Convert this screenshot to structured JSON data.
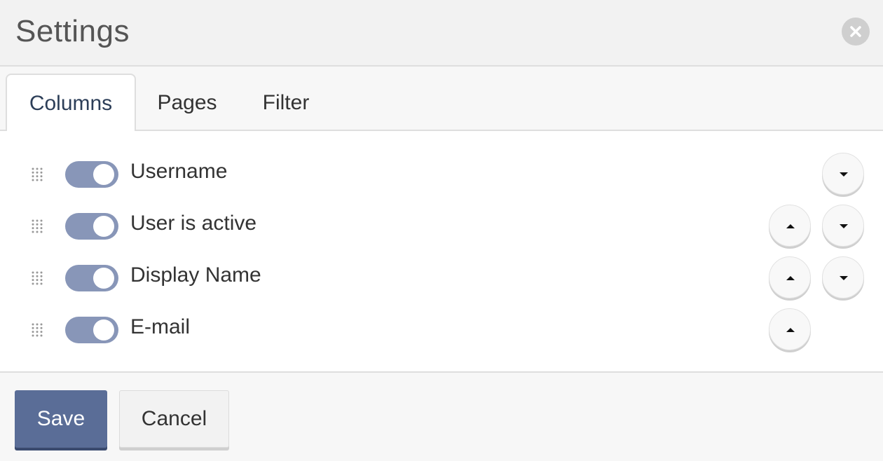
{
  "dialog": {
    "title": "Settings",
    "close_icon": "close-icon"
  },
  "tabs": [
    {
      "label": "Columns",
      "active": true
    },
    {
      "label": "Pages",
      "active": false
    },
    {
      "label": "Filter",
      "active": false
    }
  ],
  "columns": [
    {
      "label": "Username",
      "enabled": true,
      "can_move_up": false,
      "can_move_down": true
    },
    {
      "label": "User is active",
      "enabled": true,
      "can_move_up": true,
      "can_move_down": true
    },
    {
      "label": "Display Name",
      "enabled": true,
      "can_move_up": true,
      "can_move_down": true
    },
    {
      "label": "E-mail",
      "enabled": true,
      "can_move_up": true,
      "can_move_down": false
    }
  ],
  "footer": {
    "save_label": "Save",
    "cancel_label": "Cancel"
  },
  "colors": {
    "primary": "#5a6d97",
    "toggle_on": "#8896b8",
    "active_tab_text": "#2c3e58"
  }
}
